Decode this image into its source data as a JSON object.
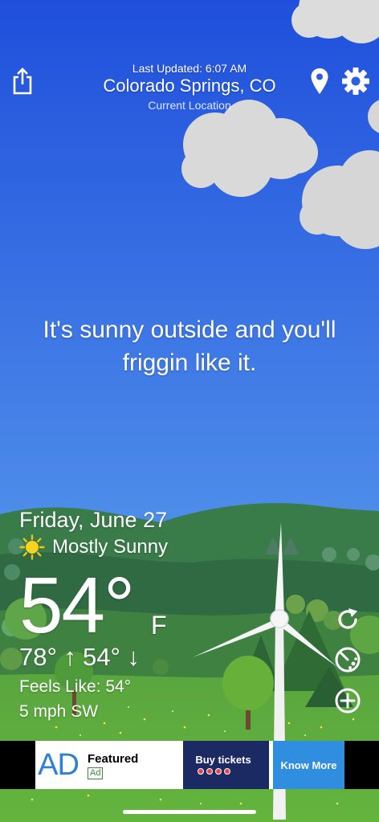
{
  "header": {
    "last_updated": "Last Updated: 6:07 AM",
    "location": "Colorado Springs, CO",
    "location_sub": "Current Location"
  },
  "toolbar": {
    "share_icon": "share-icon",
    "location_icon": "location-pin-icon",
    "settings_icon": "gear-icon"
  },
  "message": "It's sunny outside and you'll friggin like it.",
  "weather": {
    "date": "Friday, June 27",
    "condition": "Mostly Sunny",
    "condition_icon": "sun-icon",
    "temperature": "54°",
    "unit": "F",
    "high": "78° ↑",
    "low": "54° ↓",
    "feels_like": "Feels Like: 54°",
    "wind": "5 mph SW"
  },
  "side_controls": {
    "refresh_icon": "refresh-icon",
    "radar_icon": "radar-icon",
    "add_icon": "add-icon"
  },
  "ad": {
    "mark": "AD",
    "featured": "Featured",
    "label": "Ad",
    "promo": "Buy tickets",
    "cta": "Know More"
  },
  "colors": {
    "sky_top": "#1f4fdc",
    "sky_bottom": "#6aaaf2",
    "grass": "#58a63a",
    "hills": "#2f6a43",
    "ad_cta": "#2f8ee0",
    "ad_promo": "#1b2a63"
  }
}
